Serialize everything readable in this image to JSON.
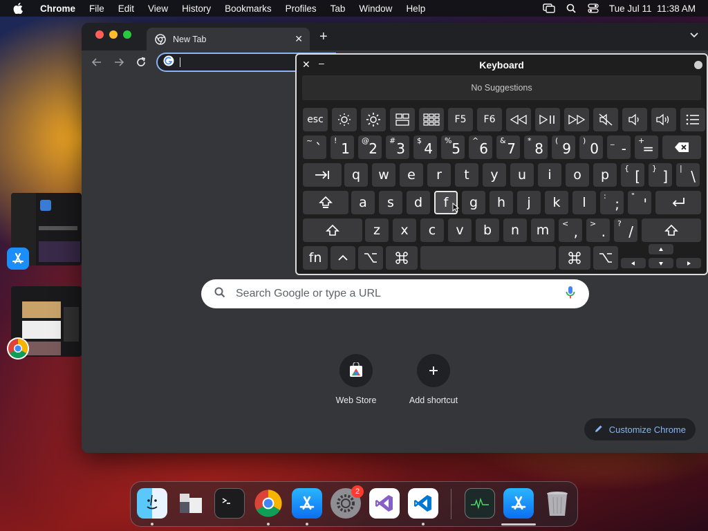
{
  "menubar": {
    "app_name": "Chrome",
    "items": [
      "File",
      "Edit",
      "View",
      "History",
      "Bookmarks",
      "Profiles",
      "Tab",
      "Window",
      "Help"
    ],
    "clock": "Tue Jul 11  11:38 AM"
  },
  "browser": {
    "tab_title": "New Tab",
    "omnibox_value": "",
    "search_placeholder": "Search Google or type a URL",
    "shortcuts": [
      {
        "label": "Web Store",
        "icon": "web-store-icon"
      },
      {
        "label": "Add shortcut",
        "icon": "plus-icon"
      }
    ],
    "customize_label": "Customize Chrome"
  },
  "keyboard_viewer": {
    "title": "Keyboard",
    "suggestions": "No Suggestions",
    "function_row": [
      "esc",
      "brightness-down",
      "brightness-up",
      "mission-control",
      "launchpad",
      "F5",
      "F6",
      "rewind",
      "play-pause",
      "fast-forward",
      "mute",
      "volume-down",
      "volume-up",
      "list"
    ],
    "number_row": [
      {
        "shift": "~",
        "main": "`"
      },
      {
        "shift": "!",
        "main": "1"
      },
      {
        "shift": "@",
        "main": "2"
      },
      {
        "shift": "#",
        "main": "3"
      },
      {
        "shift": "$",
        "main": "4"
      },
      {
        "shift": "%",
        "main": "5"
      },
      {
        "shift": "^",
        "main": "6"
      },
      {
        "shift": "&",
        "main": "7"
      },
      {
        "shift": "*",
        "main": "8"
      },
      {
        "shift": "(",
        "main": "9"
      },
      {
        "shift": ")",
        "main": "0"
      },
      {
        "shift": "_",
        "main": "-"
      },
      {
        "shift": "+",
        "main": "="
      }
    ],
    "row_q": [
      "q",
      "w",
      "e",
      "r",
      "t",
      "y",
      "u",
      "i",
      "o",
      "p"
    ],
    "row_q_extra": [
      {
        "shift": "{",
        "main": "["
      },
      {
        "shift": "}",
        "main": "]"
      },
      {
        "shift": "|",
        "main": "\\"
      }
    ],
    "row_a": [
      "a",
      "s",
      "d",
      "f",
      "g",
      "h",
      "j",
      "k",
      "l"
    ],
    "row_a_extra": [
      {
        "shift": ":",
        "main": ";"
      },
      {
        "shift": "\"",
        "main": "'"
      }
    ],
    "row_z": [
      "z",
      "x",
      "c",
      "v",
      "b",
      "n",
      "m"
    ],
    "row_z_extra": [
      {
        "shift": "<",
        "main": ","
      },
      {
        "shift": ">",
        "main": "."
      },
      {
        "shift": "?",
        "main": "/"
      }
    ],
    "bottom_fn": "fn",
    "pressed_key": "f"
  },
  "dock": {
    "apps": [
      "Finder",
      "Preview",
      "Terminal",
      "Chrome",
      "App Store",
      "System Settings",
      "Visual Studio",
      "Visual Studio Code",
      "Activity Monitor",
      "App Store Downloads",
      "Trash"
    ],
    "settings_badge": "2"
  },
  "colors": {
    "accent": "#8ab4f8",
    "chrome_bg": "#35363a",
    "keyboard_bg": "#1e1e1e",
    "key_bg": "#3a3a3c"
  }
}
